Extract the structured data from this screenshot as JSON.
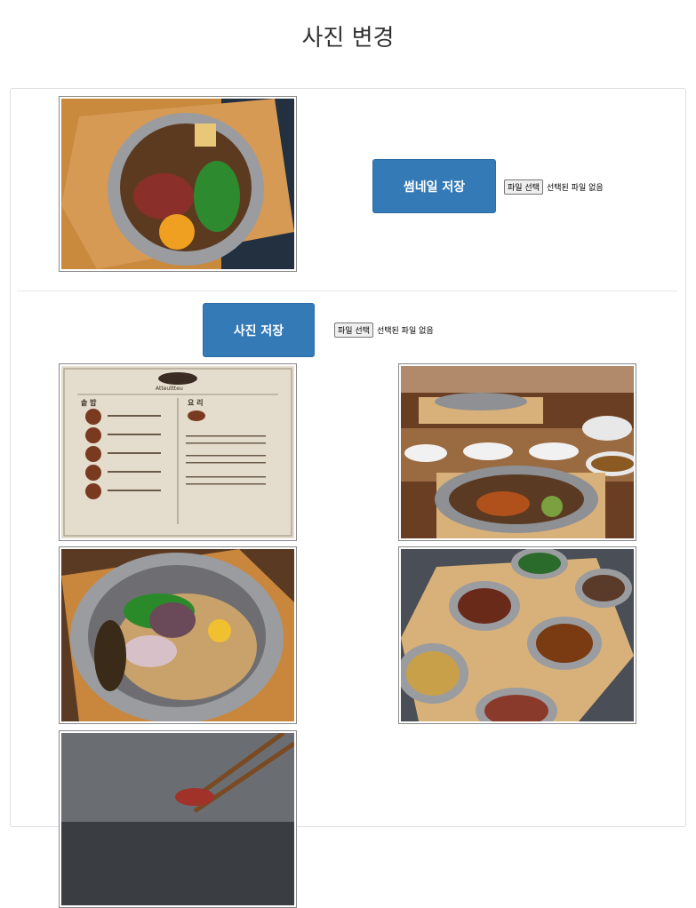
{
  "page": {
    "title": "사진 변경"
  },
  "thumbnail": {
    "save_label": "썸네일 저장",
    "file_button": "파일 선택",
    "file_status": "선택된 파일 없음"
  },
  "photos": {
    "save_label": "사진 저장",
    "file_button": "파일 선택",
    "file_status": "선택된 파일 없음"
  },
  "menu_image": {
    "brand": "Atteuttteu",
    "section_left": "솥 밥",
    "section_right": "요 리"
  },
  "colors": {
    "accent": "#337ab7"
  }
}
